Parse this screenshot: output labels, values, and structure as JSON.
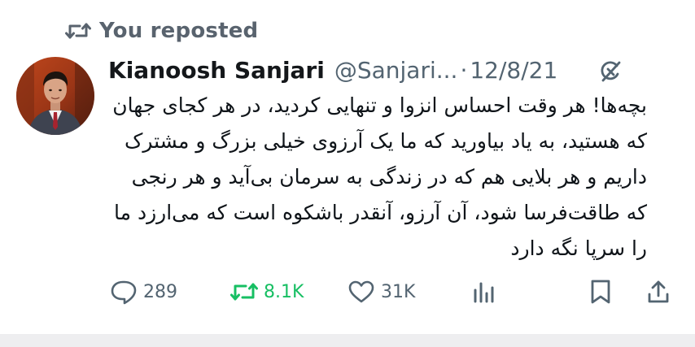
{
  "repost_header": {
    "icon": "repost-icon",
    "text": "You reposted"
  },
  "tweet": {
    "author_name": "Kianoosh Sanjari",
    "handle": "@Sanjari...",
    "separator": "·",
    "date": "12/8/21",
    "avatar": "author-avatar",
    "text": "بچه‌ها! هر وقت احساس انزوا و تنهایی کردید، در هر کجای جهان که هستید، به یاد بیاورید که ما یک آرزوی خیلی بزرگ و مشترک داریم و هر بلایی هم که در زندگی به سرمان بی‌آید و هر رنجی که طاقت‌فرسا شود، آن آرزو، آنقدر باشکوه است که می‌ارزد ما را سرپا نگه دارد"
  },
  "actions": {
    "reply_count": "289",
    "repost_count": "8.1K",
    "like_count": "31K"
  },
  "colors": {
    "repost_active": "#17bf63",
    "text_secondary": "#536471",
    "text_primary": "#0f1419"
  }
}
